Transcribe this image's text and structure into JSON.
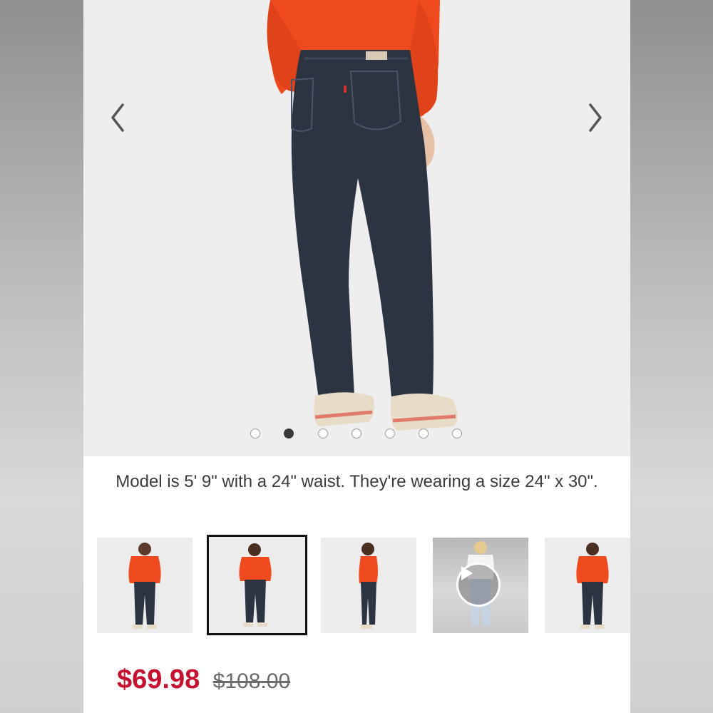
{
  "gallery": {
    "prev_icon": "chevron-left-icon",
    "next_icon": "chevron-right-icon",
    "dot_count": 7,
    "active_dot": 1
  },
  "caption": "Model is 5' 9\" with a 24\" waist. They're wearing a size 24\" x 30\".",
  "thumbnails": [
    {
      "label": "front view",
      "type": "image"
    },
    {
      "label": "back view",
      "type": "image",
      "selected": true
    },
    {
      "label": "side view",
      "type": "image"
    },
    {
      "label": "video",
      "type": "video",
      "icon": "play-icon"
    },
    {
      "label": "front view alt",
      "type": "image"
    }
  ],
  "price": {
    "sale": "$69.98",
    "original": "$108.00"
  },
  "colors": {
    "sale_price": "#c41230",
    "sweater": "#ef4a1e",
    "denim": "#2c3442"
  }
}
